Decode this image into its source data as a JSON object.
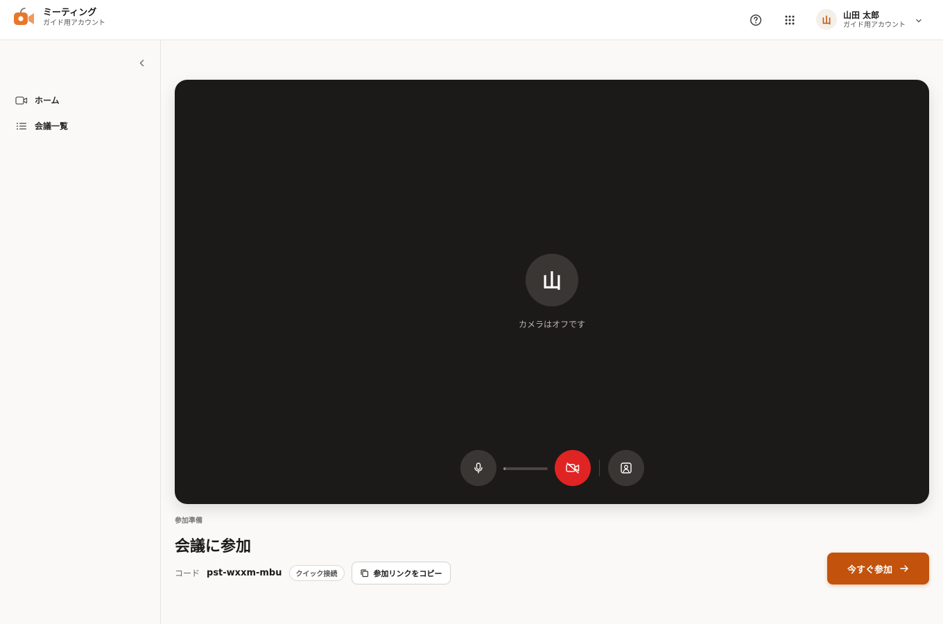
{
  "header": {
    "app_title": "ミーティング",
    "account_type": "ガイド用アカウント",
    "help_icon": "help-circle-icon",
    "apps_icon": "grid-icon",
    "user": {
      "avatar_initial": "山",
      "name": "山田 太郎",
      "account": "ガイド用アカウント"
    }
  },
  "sidebar": {
    "collapse_icon": "chevron-left-icon",
    "items": [
      {
        "label": "ホーム",
        "icon": "video-icon"
      },
      {
        "label": "会議一覧",
        "icon": "list-icon"
      }
    ]
  },
  "preview": {
    "avatar_initial": "山",
    "camera_status": "カメラはオフです",
    "mic_level": 0.05,
    "controls": [
      {
        "name": "mic",
        "icon": "microphone-icon",
        "state": "on"
      },
      {
        "name": "camera",
        "icon": "video-off-icon",
        "state": "off"
      },
      {
        "name": "background",
        "icon": "portrait-icon",
        "state": "neutral"
      }
    ]
  },
  "join": {
    "eyebrow": "参加準備",
    "title": "会議に参加",
    "code_label": "コード",
    "code_value": "pst-wxxm-mbu",
    "badge": "クイック接続",
    "copy_label": "参加リンクをコピー",
    "join_label": "今すぐ参加"
  },
  "colors": {
    "accent": "#c2520c",
    "danger": "#e02424",
    "preview_bg": "#1c1a19"
  }
}
